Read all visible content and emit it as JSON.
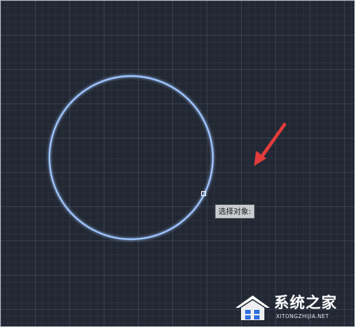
{
  "canvas": {
    "background": "#222833",
    "grid_color": "#3a4352"
  },
  "drawing": {
    "circle_color": "#9ec4ff",
    "pickbox_color": "#ffffff",
    "arrow_color": "#e23b3b"
  },
  "tooltip": {
    "text": "选择对象:"
  },
  "watermark": {
    "title": "系统之家",
    "subtitle": "XITONGZHIJIA.NET",
    "icon": "house-logo-icon"
  }
}
